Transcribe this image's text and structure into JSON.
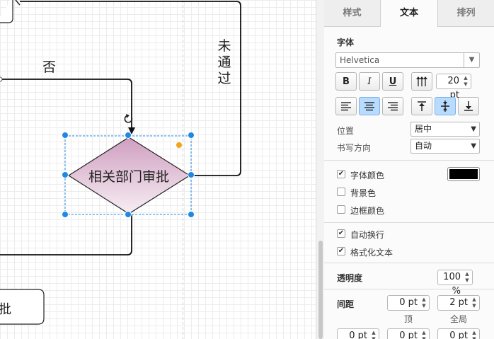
{
  "canvas": {
    "label_no": "否",
    "label_pass": "未\n通\n过",
    "diamond_text": "相关部门审批",
    "bottom_partial_text": "批"
  },
  "colors": {
    "selection": "#1e88e5",
    "diamond_fill_top": "#cf9fc0",
    "diamond_fill_bottom": "#f7eef4",
    "accent": "#b8dcff",
    "handle_orange": "#f4a31c"
  },
  "panel": {
    "tabs": [
      {
        "label": "样式",
        "active": false
      },
      {
        "label": "文本",
        "active": true
      },
      {
        "label": "排列",
        "active": false
      }
    ],
    "font_heading": "字体",
    "font_value": "Helvetica",
    "format_buttons": {
      "bold": "B",
      "italic": "I",
      "underline": "U"
    },
    "font_size": "20 pt",
    "position_label": "位置",
    "position_value": "居中",
    "writing_dir_label": "书写方向",
    "writing_dir_value": "自动",
    "checks": [
      {
        "label": "字体颜色",
        "checked": true
      },
      {
        "label": "背景色",
        "checked": false
      },
      {
        "label": "边框颜色",
        "checked": false
      },
      {
        "label": "自动换行",
        "checked": true
      },
      {
        "label": "格式化文本",
        "checked": true
      }
    ],
    "font_color": "#000000",
    "opacity_label": "透明度",
    "opacity_value": "100 %",
    "spacing_label": "间距",
    "spacing_top_value": "0 pt",
    "spacing_top_label": "顶",
    "spacing_global_value": "2 pt",
    "spacing_global_label": "全局",
    "spacing_row2": [
      "0 pt",
      "0 pt",
      "0 pt"
    ]
  }
}
